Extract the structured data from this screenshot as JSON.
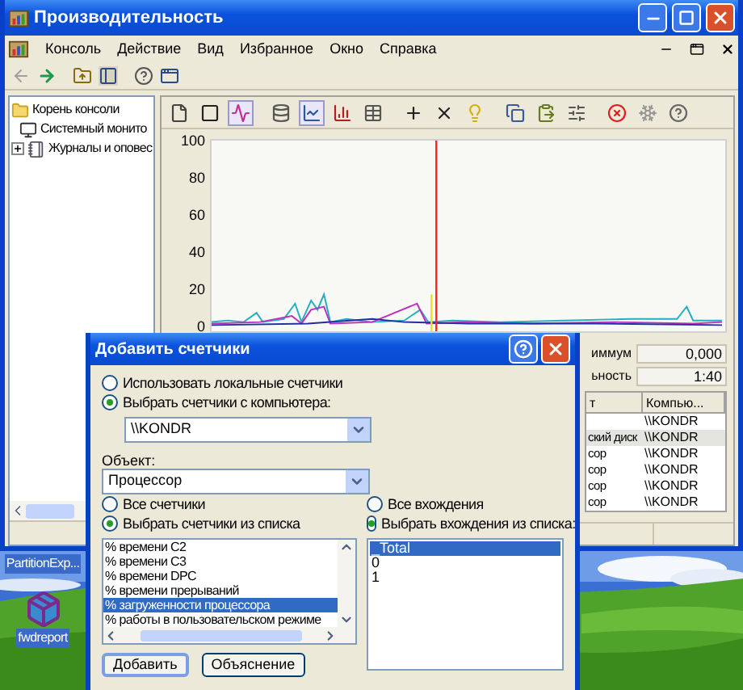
{
  "main_window": {
    "title": "Производительность",
    "menu": [
      "Консоль",
      "Действие",
      "Вид",
      "Избранное",
      "Окно",
      "Справка"
    ],
    "tree": [
      {
        "label": "Корень консоли",
        "kind": "folder",
        "children": [
          {
            "label": "Системный монито",
            "kind": "monitor"
          },
          {
            "label": "Журналы и оповес",
            "kind": "logs"
          }
        ]
      }
    ],
    "chart": {
      "y_labels": [
        "100",
        "80",
        "60",
        "40",
        "20",
        "0"
      ]
    },
    "stats": [
      {
        "label": "иммум",
        "value": "0,000"
      },
      {
        "label": "ьность",
        "value": "1:40"
      }
    ],
    "table": {
      "columns": [
        "т",
        "Компью..."
      ],
      "rows": [
        {
          "computer": "\\\\KONDR",
          "selected": false
        },
        {
          "object": "ский диск",
          "computer": "\\\\KONDR",
          "selected": true
        },
        {
          "object": "сор",
          "computer": "\\\\KONDR",
          "selected": false
        },
        {
          "object": "сор",
          "computer": "\\\\KONDR",
          "selected": false
        },
        {
          "object": "сор",
          "computer": "\\\\KONDR",
          "selected": false
        },
        {
          "object": "сор",
          "computer": "\\\\KONDR",
          "selected": false
        }
      ]
    }
  },
  "desktop_icons": [
    {
      "label": "PartitionExp...",
      "kind": "plain"
    },
    {
      "label": "fwdreport",
      "kind": "archive"
    }
  ],
  "dialog": {
    "title": "Добавить счетчики",
    "source_options": [
      {
        "label": "Использовать локальные счетчики",
        "selected": false
      },
      {
        "label": "Выбрать счетчики с компьютера:",
        "selected": true
      }
    ],
    "computer": "\\\\KONDR",
    "object_label": "Объект:",
    "object": "Процессор",
    "counter_options": [
      {
        "label": "Все счетчики",
        "selected": false
      },
      {
        "label": "Выбрать счетчики из списка",
        "selected": true
      }
    ],
    "counters": [
      {
        "label": "% времени C2",
        "selected": false
      },
      {
        "label": "% времени C3",
        "selected": false
      },
      {
        "label": "% времени DPC",
        "selected": false
      },
      {
        "label": "% времени прерываний",
        "selected": false
      },
      {
        "label": "% загруженности процессора",
        "selected": true
      },
      {
        "label": "% работы в пользовательском режиме",
        "selected": false
      }
    ],
    "instance_options": [
      {
        "label": "Все вхождения",
        "selected": false
      },
      {
        "label": "Выбрать вхождения из списка:",
        "selected": true
      }
    ],
    "instances": [
      {
        "label": "_Total",
        "selected": true
      },
      {
        "label": "0",
        "selected": false
      },
      {
        "label": "1",
        "selected": false
      }
    ],
    "buttons": [
      "Добавить",
      "Объяснение"
    ]
  }
}
